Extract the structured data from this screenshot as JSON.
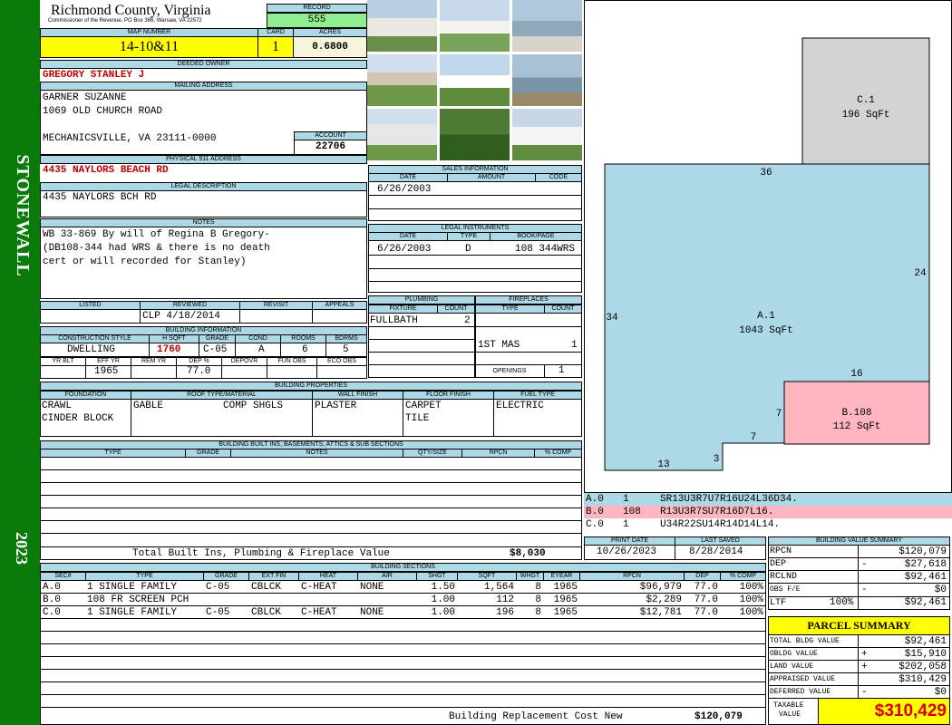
{
  "sidebar": {
    "district": "STONEWALL",
    "year": "2023",
    "color": "#0a7a0a"
  },
  "header": {
    "county": "Richmond County, Virginia",
    "commissioner": "Commissioner of the Revenue, PO Box 366, Warsaw, VA 22572",
    "record_label": "RECORD",
    "record": "555",
    "map_label": "MAP NUMBER",
    "map_number": "14-10&11",
    "card_label": "CARD",
    "card": "1",
    "acres_label": "ACRES",
    "acres": "0.6800"
  },
  "owner": {
    "deeded_label": "DEEDED OWNER",
    "deeded_owner": "GREGORY STANLEY J",
    "mailing_label": "MAILING ADDRESS",
    "mailing_line1": "GARNER SUZANNE",
    "mailing_line2": "1069 OLD CHURCH ROAD",
    "mailing_line3": "MECHANICSVILLE, VA 23111-0000",
    "account_label": "ACCOUNT",
    "account": "22706",
    "physical_label": "PHYSICAL 911 ADDRESS",
    "physical_address": "4435 NAYLORS BEACH RD",
    "legal_label": "LEGAL DESCRIPTION",
    "legal": "4435 NAYLORS BCH RD",
    "notes_label": "NOTES",
    "notes_line1": "WB 33-869 By will of Regina B Gregory-",
    "notes_line2": "(DB108-344 had WRS & there is no death",
    "notes_line3": "cert or will recorded for Stanley)"
  },
  "photos": [
    "house-photo",
    "cottage-photo",
    "pier-photo",
    "yard-photo",
    "cabin-photo",
    "dock-photo",
    "rear-house-photo",
    "sign-photo",
    "white-house-photo"
  ],
  "sales": {
    "title": "SALES INFORMATION",
    "col_date": "DATE",
    "col_amount": "AMOUNT",
    "col_code": "CODE",
    "row1_date": "6/26/2003"
  },
  "legal_instruments": {
    "title": "LEGAL INSTRUMENTS",
    "col_date": "DATE",
    "col_type": "TYPE",
    "col_bookpage": "BOOK/PAGE",
    "row1_date": "6/26/2003",
    "row1_type": "D",
    "row1_bookpage": "108 344WRS"
  },
  "review": {
    "listed_label": "LISTED",
    "reviewed_label": "REVIEWED",
    "revisit_label": "REVISIT",
    "appeals_label": "APPEALS",
    "reviewed": "CLP  4/18/2014"
  },
  "building_info": {
    "title": "BUILDING INFORMATION",
    "style_label": "CONSTRUCTION STYLE",
    "style": "DWELLING",
    "hsqft_label": "H SQFT",
    "hsqft": "1760",
    "grade_label": "GRADE",
    "grade": "C-05",
    "cond_label": "COND",
    "cond": "A",
    "rooms_label": "ROOMS",
    "rooms": "6",
    "bdrms_label": "BDRMS",
    "bdrms": "5",
    "yrblt_label": "YR BLT",
    "effyr_label": "EFF YR",
    "effyr": "1965",
    "remyr_label": "REM YR",
    "dep_label": "DEP %",
    "dep": "77.0",
    "depovr_label": "DEPOVR",
    "funobs_label": "FUN OBS",
    "ecoobs_label": "ECO OBS"
  },
  "plumbing": {
    "title": "PLUMBING",
    "col_fixture": "FIXTURE",
    "col_count": "COUNT",
    "fixture": "FULLBATH",
    "count": "2"
  },
  "fireplaces": {
    "title": "FIREPLACES",
    "col_type": "TYPE",
    "col_count": "COUNT",
    "type": "1ST MAS",
    "count": "1",
    "openings_label": "OPENINGS",
    "openings": "1"
  },
  "building_properties": {
    "title": "BUILDING PROPERTIES",
    "foundation_label": "FOUNDATION",
    "foundation1": "CRAWL",
    "foundation2": "CINDER BLOCK",
    "roof_label": "ROOF TYPE/MATERIAL",
    "roof_type": "GABLE",
    "roof_material": "COMP SHGLS",
    "wall_label": "WALL FINISH",
    "wall": "PLASTER",
    "floor_label": "FLOOR FINISH",
    "floor1": "CARPET",
    "floor2": "TILE",
    "fuel_label": "FUEL TYPE",
    "fuel": "ELECTRIC"
  },
  "builtins": {
    "title": "BUILDING BUILT INS, BASEMENTS, ATTICS & SUB SECTIONS",
    "col_type": "TYPE",
    "col_grade": "GRADE",
    "col_notes": "NOTES",
    "col_qty": "QTY/SIZE",
    "col_rpcn": "RPCN",
    "col_comp": "% COMP",
    "total_label": "Total Built Ins, Plumbing & Fireplace Value",
    "total": "$8,030"
  },
  "sketch": {
    "sections": [
      {
        "label": "C.1",
        "area": "196 SqFt",
        "color": "#d3d3d3"
      },
      {
        "label": "A.1",
        "area": "1043 SqFt",
        "color": "#add8e6"
      },
      {
        "label": "B.108",
        "area": "112 SqFt",
        "color": "#ffb6c1"
      }
    ],
    "dims": [
      "36",
      "24",
      "34",
      "16",
      "7",
      "7",
      "13",
      "3"
    ],
    "legend": [
      {
        "code": "A.0",
        "num": "1",
        "path": "SR13U3R7U7R16U24L36D34.",
        "color": "#add8e6"
      },
      {
        "code": "B.0",
        "num": "108",
        "path": "R13U3R7SU7R16D7L16.",
        "color": "#ffb6c1"
      },
      {
        "code": "C.0",
        "num": "1",
        "path": "U34R22SU14R14D14L14.",
        "color": "#ffffff"
      }
    ]
  },
  "dates": {
    "print_label": "PRINT DATE",
    "print_date": "10/26/2023",
    "saved_label": "LAST SAVED",
    "saved_date": "8/28/2014"
  },
  "value_summary": {
    "title": "BUILDING VALUE SUMMARY",
    "rows": [
      {
        "label": "RPCN",
        "sign": "",
        "pct": "",
        "value": "$120,079"
      },
      {
        "label": "DEP",
        "sign": "-",
        "pct": "",
        "value": "$27,618"
      },
      {
        "label": "RCLND",
        "sign": "",
        "pct": "",
        "value": "$92,461"
      },
      {
        "label": "OBS F/E",
        "sign": "-",
        "pct": "",
        "value": "$0"
      },
      {
        "label": "LTF",
        "sign": "",
        "pct": "100%",
        "value": "$92,461"
      }
    ]
  },
  "parcel_summary": {
    "title": "PARCEL SUMMARY",
    "rows": [
      {
        "label": "TOTAL BLDG VALUE",
        "sign": "",
        "value": "$92,461"
      },
      {
        "label": "OBLDG VALUE",
        "sign": "+",
        "value": "$15,910"
      },
      {
        "label": "LAND VALUE",
        "sign": "+",
        "value": "$202,058"
      },
      {
        "label": "APPRAISED VALUE",
        "sign": "",
        "value": "$310,429"
      },
      {
        "label": "DEFERRED VALUE",
        "sign": "-",
        "value": "$0"
      }
    ],
    "taxable_label1": "TAXABLE",
    "taxable_label2": "VALUE",
    "taxable_value": "$310,429",
    "title_color": "#ffff00"
  },
  "sections": {
    "title": "BUILDING SECTIONS",
    "columns": [
      "SEC#",
      "TYPE",
      "GRADE",
      "EXT FIN",
      "HEAT",
      "AIR",
      "SHGT",
      "SQFT",
      "WHGT",
      "EYEAR",
      "RPCN",
      "DEP",
      "% COMP"
    ],
    "rows": [
      [
        "A.0",
        "1 SINGLE FAMILY",
        "C-05",
        "CBLCK",
        "C-HEAT",
        "NONE",
        "1.50",
        "1,564",
        "8",
        "1965",
        "$96,979",
        "77.0",
        "100%"
      ],
      [
        "B.0",
        "108 FR SCREEN PCH",
        "",
        "",
        "",
        "",
        "1.00",
        "112",
        "8",
        "1965",
        "$2,289",
        "77.0",
        "100%"
      ],
      [
        "C.0",
        "1 SINGLE FAMILY",
        "C-05",
        "CBLCK",
        "C-HEAT",
        "NONE",
        "1.00",
        "196",
        "8",
        "1965",
        "$12,781",
        "77.0",
        "100%"
      ]
    ],
    "replacement_label": "Building Replacement Cost New",
    "replacement_value": "$120,079"
  }
}
